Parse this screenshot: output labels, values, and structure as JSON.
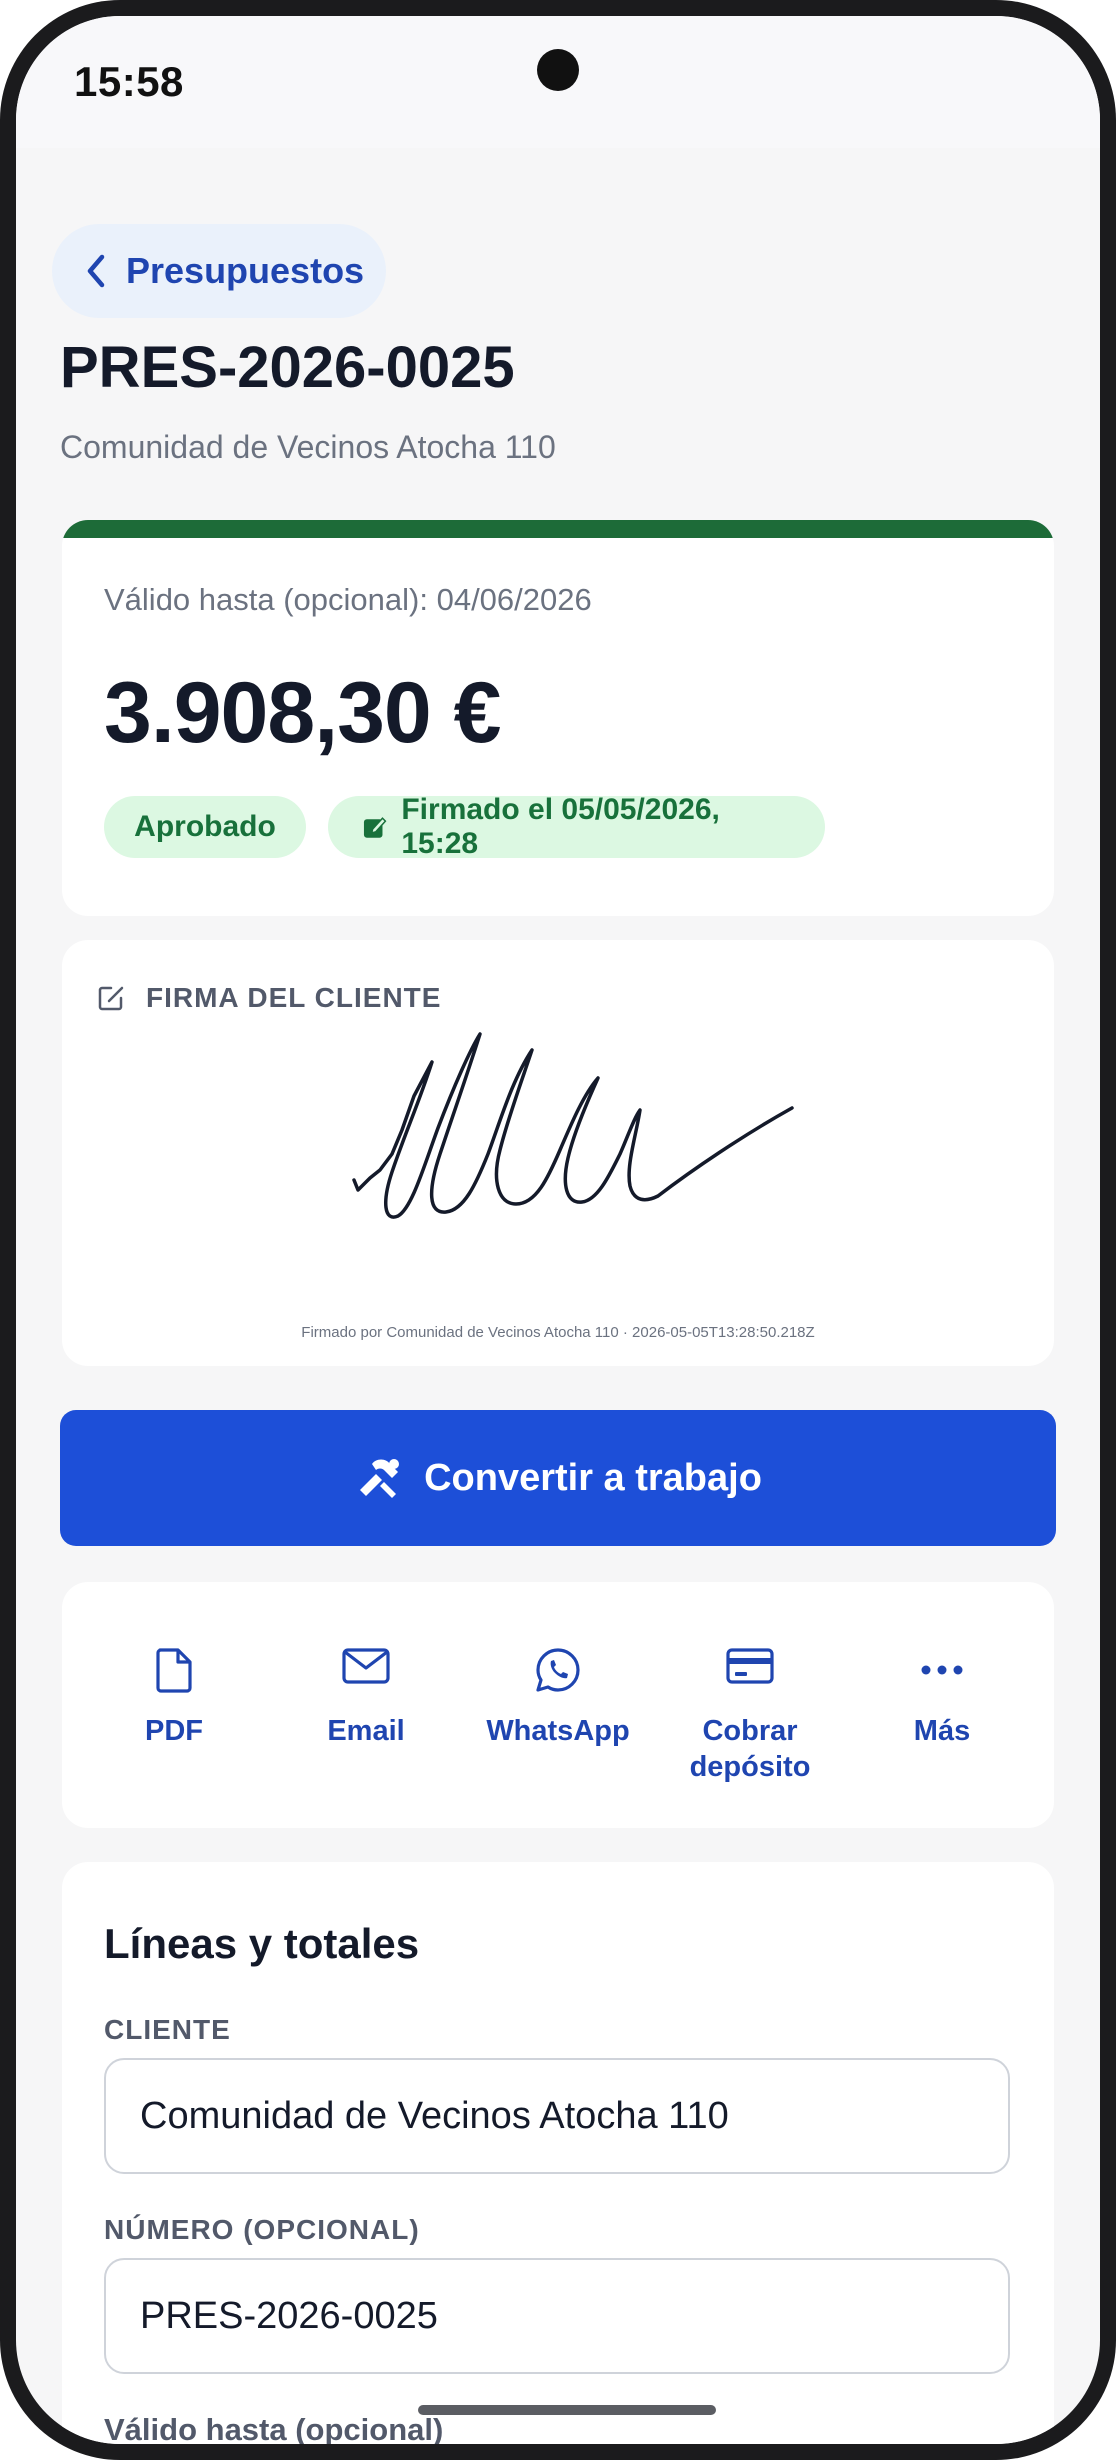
{
  "status_bar": {
    "time": "15:58"
  },
  "nav": {
    "back_label": "Presupuestos"
  },
  "header": {
    "title": "PRES-2026-0025",
    "subtitle": "Comunidad de Vecinos Atocha 110"
  },
  "summary": {
    "valid_until": "Válido hasta (opcional): 04/06/2026",
    "amount": "3.908,30 €",
    "status_badge": "Aprobado",
    "signed_badge": "Firmado el 05/05/2026, 15:28",
    "accent_color": "#1d6b38"
  },
  "signature": {
    "heading": "FIRMA DEL CLIENTE",
    "caption": "Firmado por Comunidad de Vecinos Atocha 110 · 2026-05-05T13:28:50.218Z"
  },
  "primary_action": {
    "label": "Convertir a trabajo",
    "icon": "tools-icon",
    "color": "#1d4fd8"
  },
  "actions": [
    {
      "label": "PDF",
      "icon": "document-icon"
    },
    {
      "label": "Email",
      "icon": "mail-icon"
    },
    {
      "label": "WhatsApp",
      "icon": "whatsapp-icon"
    },
    {
      "label": "Cobrar depósito",
      "icon": "credit-card-icon"
    },
    {
      "label": "Más",
      "icon": "more-icon"
    }
  ],
  "lines_section": {
    "title": "Líneas y totales",
    "client_label": "CLIENTE",
    "client_value": "Comunidad de Vecinos Atocha 110",
    "number_label": "NÚMERO (OPCIONAL)",
    "number_value": "PRES-2026-0025",
    "valid_label": "Válido hasta (opcional)"
  }
}
